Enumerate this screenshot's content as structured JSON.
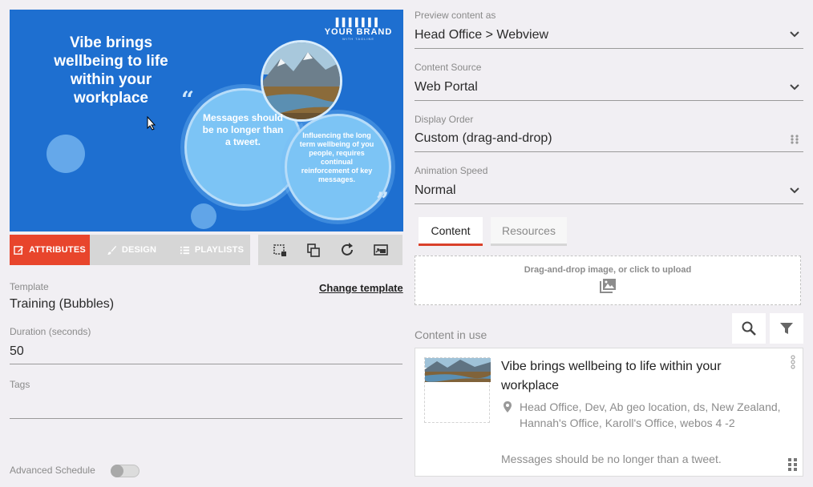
{
  "preview": {
    "headline": "Vibe brings wellbeing to life within your workplace",
    "brand_name": "YOUR BRAND",
    "brand_tag": "WITH TAGLINE",
    "bubble_big": "Messages should be no longer than a tweet.",
    "bubble_small": "Influencing the long term wellbeing of you people, requires continual reinforcement of key messages."
  },
  "tabs": [
    {
      "label": "ATTRIBUTES",
      "icon": "edit-icon",
      "active": true
    },
    {
      "label": "DESIGN",
      "icon": "brush-icon",
      "active": false
    },
    {
      "label": "PLAYLISTS",
      "icon": "list-icon",
      "active": false
    }
  ],
  "tools": [
    "crop-icon",
    "copy-icon",
    "refresh-icon",
    "cast-icon"
  ],
  "template": {
    "label": "Template",
    "value": "Training (Bubbles)",
    "change_link": "Change template"
  },
  "duration": {
    "label": "Duration (seconds)",
    "value": "50"
  },
  "tags": {
    "label": "Tags",
    "value": ""
  },
  "advanced_schedule": {
    "label": "Advanced Schedule",
    "enabled": false
  },
  "preview_as": {
    "label": "Preview content as",
    "value": "Head Office > Webview"
  },
  "content_source": {
    "label": "Content Source",
    "value": "Web Portal"
  },
  "display_order": {
    "label": "Display Order",
    "value": "Custom (drag-and-drop)"
  },
  "animation_speed": {
    "label": "Animation Speed",
    "value": "Normal"
  },
  "right_tabs": [
    {
      "label": "Content",
      "active": true
    },
    {
      "label": "Resources",
      "active": false
    }
  ],
  "upload": {
    "text": "Drag-and-drop image, or click to upload"
  },
  "content_in_use": {
    "label": "Content in use",
    "items": [
      {
        "title": "Vibe brings wellbeing to life within your workplace",
        "locations": "Head Office, Dev, Ab geo location, ds, New Zealand, Hannah's Office, Karoll's Office, webos 4 -2",
        "description": "Messages should be no longer than a tweet."
      }
    ]
  },
  "colors": {
    "accent": "#e8452c",
    "preview_bg": "#1e6fd0",
    "bubble": "#7cc4f5",
    "page_bg": "#f1eff3"
  }
}
